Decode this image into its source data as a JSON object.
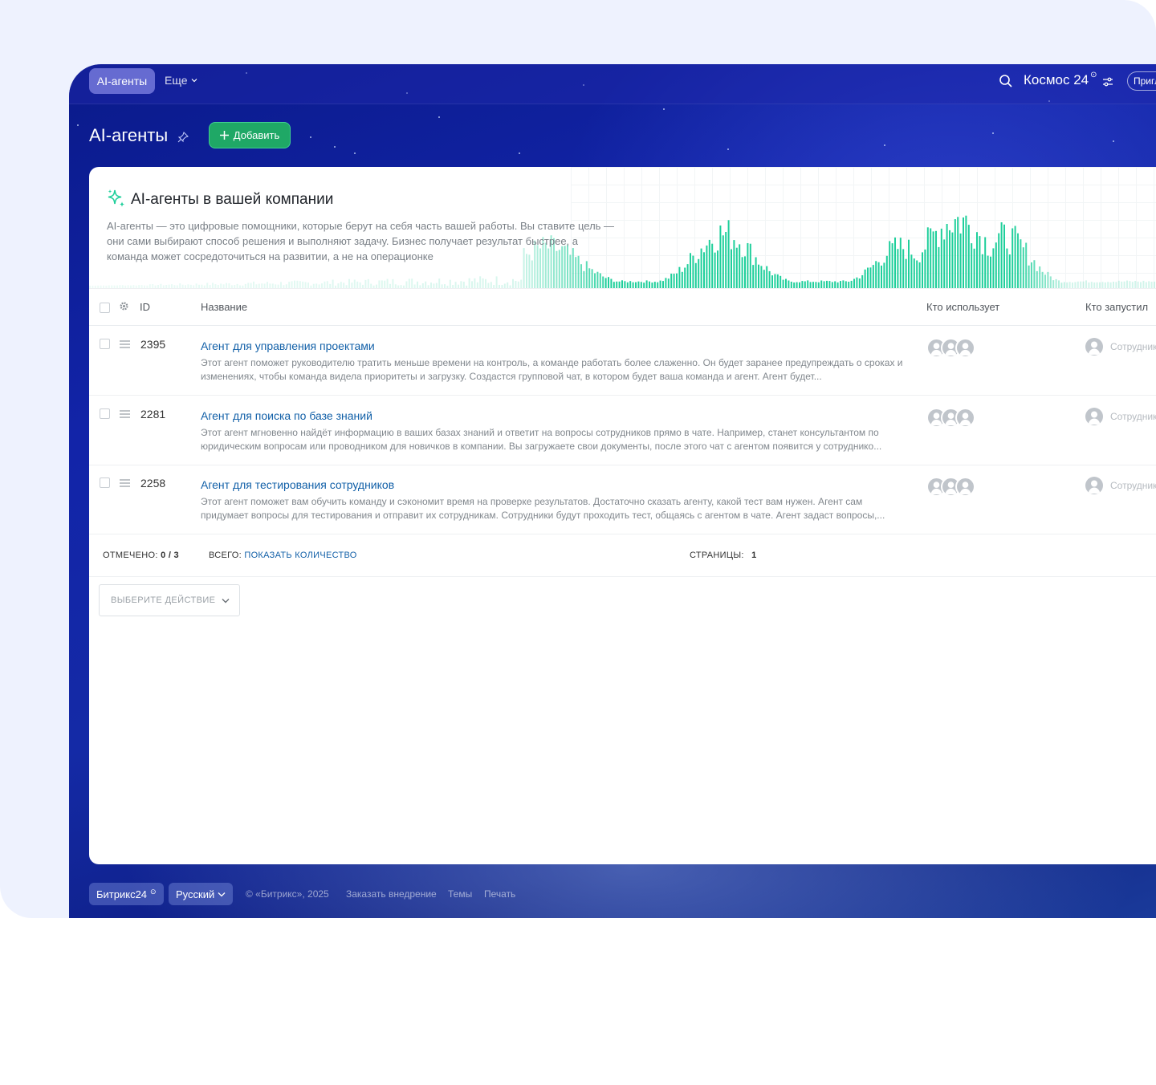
{
  "topbar": {
    "active_tab": "AI-агенты",
    "more_label": "Еще",
    "brand_name": "Космос 24",
    "brand_sup": "⊙",
    "invite_label": "Пригласить"
  },
  "header": {
    "title": "AI-агенты",
    "add_button": "Добавить"
  },
  "banner": {
    "title": "AI-агенты в вашей компании",
    "description": "AI-агенты — это цифровые помощники, которые берут на себя часть вашей работы. Вы ставите цель — они сами выбирают способ решения и выполняют задачу. Бизнес получает результат быстрее, а команда может сосредоточиться на развитии, а не на операционке",
    "accent_color": "#1fcf9b"
  },
  "table": {
    "columns": [
      "ID",
      "Название",
      "Кто использует",
      "Кто запустил"
    ],
    "rows": [
      {
        "id": "2395",
        "title": "Агент для управления проектами",
        "description": "Этот агент поможет руководителю тратить меньше времени на контроль, а команде работать более слаженно. Он будет заранее предупреждать о сроках и изменениях, чтобы команда видела приоритеты и загрузку. Создастся групповой чат, в котором будет ваша команда и агент. Агент будет...",
        "launched_by": "Сотрудник"
      },
      {
        "id": "2281",
        "title": "Агент для поиска по базе знаний",
        "description": "Этот агент мгновенно найдёт информацию в ваших базах знаний и ответит на вопросы сотрудников прямо в чате. Например, станет консультантом по юридическим вопросам или проводником для новичков в компании. Вы загружаете свои документы, после этого чат с агентом появится у сотруднико...",
        "launched_by": "Сотрудник"
      },
      {
        "id": "2258",
        "title": "Агент для тестирования сотрудников",
        "description": "Этот агент поможет вам обучить команду и сэкономит время на проверке результатов. Достаточно сказать агенту, какой тест вам нужен. Агент сам придумает вопросы для тестирования и отправит их сотрудникам. Сотрудники будут проходить тест, общаясь с агентом в чате. Агент задаст вопросы,...",
        "launched_by": "Сотрудник"
      }
    ]
  },
  "footer": {
    "checked_label": "ОТМЕЧЕНО:",
    "checked_value": "0 / 3",
    "total_label": "ВСЕГО:",
    "total_link": "ПОКАЗАТЬ КОЛИЧЕСТВО",
    "pages_label": "СТРАНИЦЫ:",
    "pages_value": "1"
  },
  "action_select": {
    "label": "ВЫБЕРИТЕ ДЕЙСТВИЕ"
  },
  "bottom": {
    "bitrix_label": "Битрикс24",
    "bitrix_sup": "⊙",
    "language": "Русский",
    "copyright": "© «Битрикс», 2025",
    "order_link": "Заказать внедрение",
    "themes_link": "Темы",
    "print_link": "Печать"
  }
}
